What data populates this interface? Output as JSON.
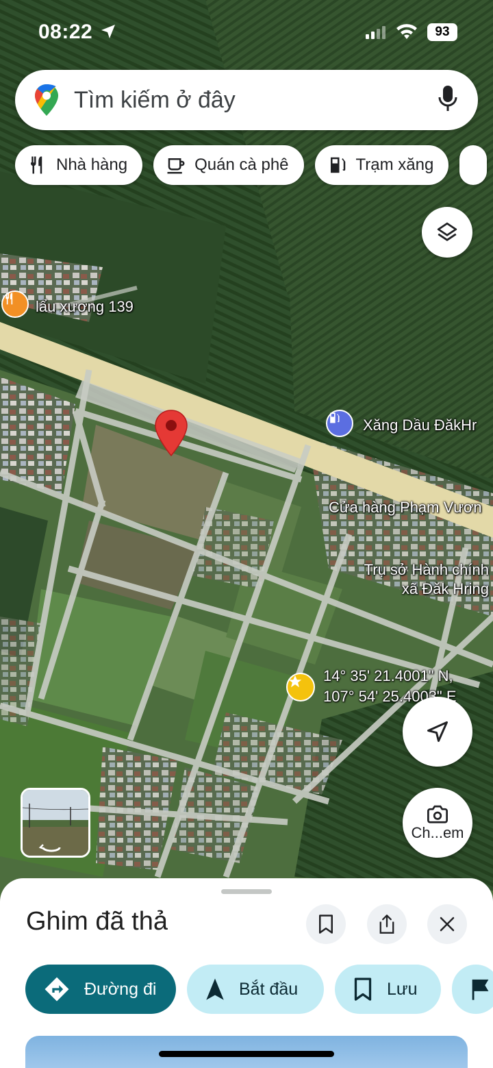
{
  "status": {
    "time": "08:22",
    "battery": "93"
  },
  "search": {
    "placeholder": "Tìm kiếm ở đây"
  },
  "chips": [
    "Nhà hàng",
    "Quán cà phê",
    "Trạm xăng"
  ],
  "map": {
    "labels": {
      "restaurant": "lẩu xương 139",
      "gas_station": "Xăng Dầu ĐăkHr",
      "shop": "Cửa hàng Phạm Vươn",
      "admin_line1": "Trụ sở Hành chính",
      "admin_line2": "xã Đăk Hring",
      "coord_line1": "14° 35' 21.4001\" N,",
      "coord_line2": "107° 54' 25.4003\" E"
    }
  },
  "buttons": {
    "camera_label": "Ch...em"
  },
  "sheet": {
    "title": "Ghim đã thả",
    "actions": {
      "directions": "Đường đi",
      "start": "Bắt đầu",
      "save": "Lưu"
    }
  },
  "colors": {
    "primary_action": "#0b6b7a",
    "secondary_action": "#c2ecf5",
    "pin": "#e53935",
    "road": "#e3d9a8"
  }
}
